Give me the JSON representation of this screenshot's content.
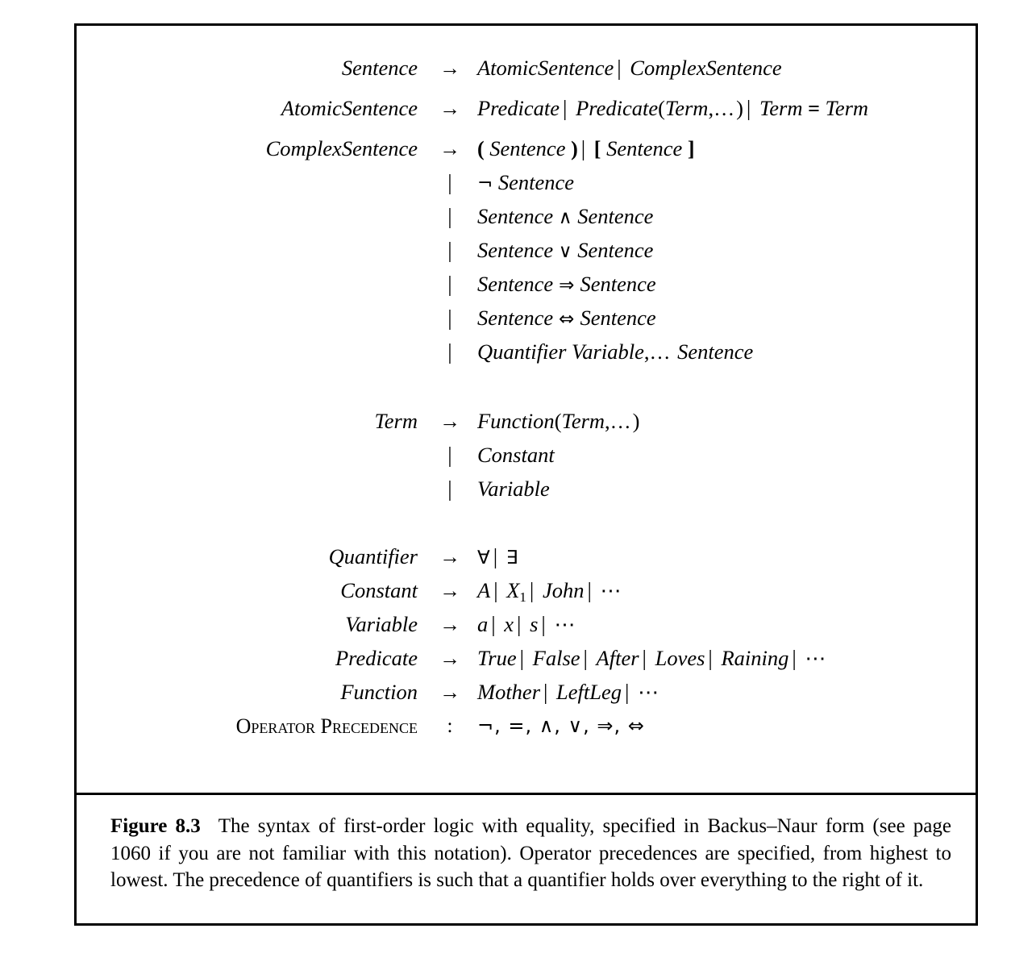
{
  "figure": {
    "label": "Figure 8.3",
    "caption": "The syntax of first-order logic with equality, specified in Backus–Naur form (see page 1060 if you are not familiar with this notation). Operator precedences are specified, from highest to lowest. The precedence of quantifiers is such that a quantifier holds over everything to the right of it."
  },
  "symbols": {
    "arrow": "→",
    "bar": "|",
    "colon": ":",
    "equals": "=",
    "lparen": "(",
    "rparen": ")",
    "lbracket": "[",
    "rbracket": "]",
    "comma": ",",
    "ellipsis": "…",
    "cdots": "⋯",
    "not": "¬",
    "and": "∧",
    "or": "∨",
    "implies": "⇒",
    "iff": "⇔",
    "forall": "∀",
    "exists": "∃"
  },
  "grammar": {
    "rules": [
      {
        "lhs": "Sentence",
        "alternatives": [
          "AtomicSentence",
          "ComplexSentence"
        ]
      },
      {
        "lhs": "AtomicSentence",
        "alternatives": [
          "Predicate",
          "Predicate(Term,…)",
          "Term = Term"
        ]
      },
      {
        "lhs": "ComplexSentence",
        "alternatives": [
          "( Sentence )",
          "[ Sentence ]",
          "¬ Sentence",
          "Sentence ∧ Sentence",
          "Sentence ∨ Sentence",
          "Sentence ⇒ Sentence",
          "Sentence ⇔ Sentence",
          "Quantifier Variable,… Sentence"
        ]
      },
      {
        "lhs": "Term",
        "alternatives": [
          "Function(Term,…)",
          "Constant",
          "Variable"
        ]
      },
      {
        "lhs": "Quantifier",
        "alternatives": [
          "∀",
          "∃"
        ]
      },
      {
        "lhs": "Constant",
        "alternatives": [
          "A",
          "X1",
          "John",
          "⋯"
        ]
      },
      {
        "lhs": "Variable",
        "alternatives": [
          "a",
          "x",
          "s",
          "⋯"
        ]
      },
      {
        "lhs": "Predicate",
        "alternatives": [
          "True",
          "False",
          "After",
          "Loves",
          "Raining",
          "⋯"
        ]
      },
      {
        "lhs": "Function",
        "alternatives": [
          "Mother",
          "LeftLeg",
          "⋯"
        ]
      }
    ]
  },
  "labels": {
    "sentence": "Sentence",
    "atomic_sentence": "AtomicSentence",
    "complex_sentence": "ComplexSentence",
    "term": "Term",
    "quantifier": "Quantifier",
    "constant": "Constant",
    "variable": "Variable",
    "predicate": "Predicate",
    "function": "Function",
    "operator_precedence": "Operator Precedence"
  },
  "terminals": {
    "predicate_word": "Predicate",
    "term_word": "Term",
    "function_word": "Function",
    "constant_word": "Constant",
    "variable_word": "Variable",
    "quantifier_word": "Quantifier",
    "const_a": "A",
    "const_x": "X",
    "const_x_sub": "1",
    "const_john": "John",
    "var_a": "a",
    "var_x": "x",
    "var_s": "s",
    "pred_true": "True",
    "pred_false": "False",
    "pred_after": "After",
    "pred_loves": "Loves",
    "pred_raining": "Raining",
    "fn_mother": "Mother",
    "fn_leftleg": "LeftLeg"
  },
  "precedence": {
    "label": "Operator Precedence",
    "separator": ":",
    "order": "¬, =, ∧, ∨, ⇒, ⇔"
  }
}
